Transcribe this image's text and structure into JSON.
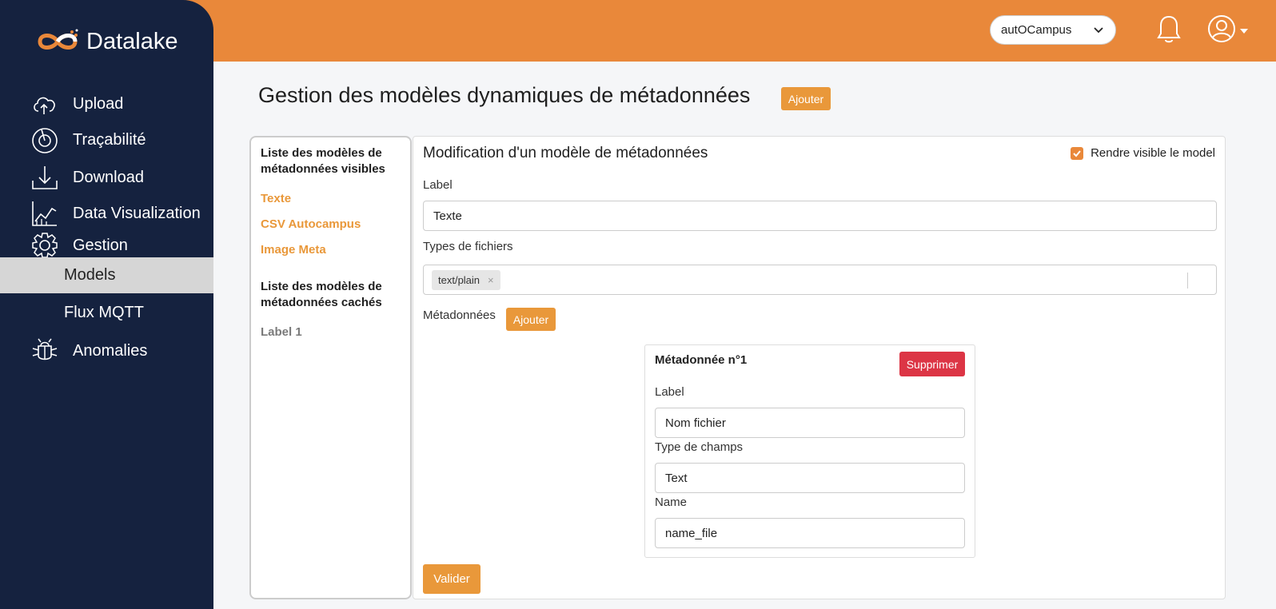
{
  "brand": {
    "name": "Datalake",
    "colors": {
      "accent": "#e9883a",
      "sidebar": "#15223f",
      "danger": "#dc3545"
    }
  },
  "header": {
    "site_select": {
      "value": "autOCampus"
    },
    "icons": [
      "bell-icon",
      "user-icon"
    ]
  },
  "sidebar": {
    "items": [
      {
        "label": "Upload",
        "icon": "cloud-upload-icon"
      },
      {
        "label": "Traçabilité",
        "icon": "target-icon"
      },
      {
        "label": "Download",
        "icon": "download-icon"
      },
      {
        "label": "Data Visualization",
        "icon": "chart-icon"
      },
      {
        "label": "Gestion",
        "icon": "gear-icon"
      }
    ],
    "sub_items": [
      {
        "label": "Models",
        "active": true
      },
      {
        "label": "Flux MQTT",
        "active": false
      }
    ],
    "anomalies": {
      "label": "Anomalies",
      "icon": "bug-icon"
    }
  },
  "page": {
    "title": "Gestion des modèles dynamiques de métadonnées",
    "add_label": "Ajouter"
  },
  "models_list": {
    "visible_heading": "Liste des modèles de métadonnées visibles",
    "visible": [
      "Texte",
      "CSV Autocampus",
      "Image Meta"
    ],
    "hidden_heading": "Liste des modèles de métadonnées cachés",
    "hidden": [
      "Label 1"
    ]
  },
  "editor": {
    "title": "Modification d'un modèle de métadonnées",
    "visible_checkbox_label": "Rendre visible le model",
    "visible_checked": true,
    "label_label": "Label",
    "label_value": "Texte",
    "file_types_label": "Types de fichiers",
    "file_types": [
      "text/plain"
    ],
    "metadata_label": "Métadonnées",
    "metadata_add_label": "Ajouter",
    "metadata": [
      {
        "title": "Métadonnée n°1",
        "delete_label": "Supprimer",
        "label_label": "Label",
        "label_value": "Nom fichier",
        "type_label": "Type de champs",
        "type_value": "Text",
        "name_label": "Name",
        "name_value": "name_file"
      }
    ],
    "validate_label": "Valider"
  }
}
